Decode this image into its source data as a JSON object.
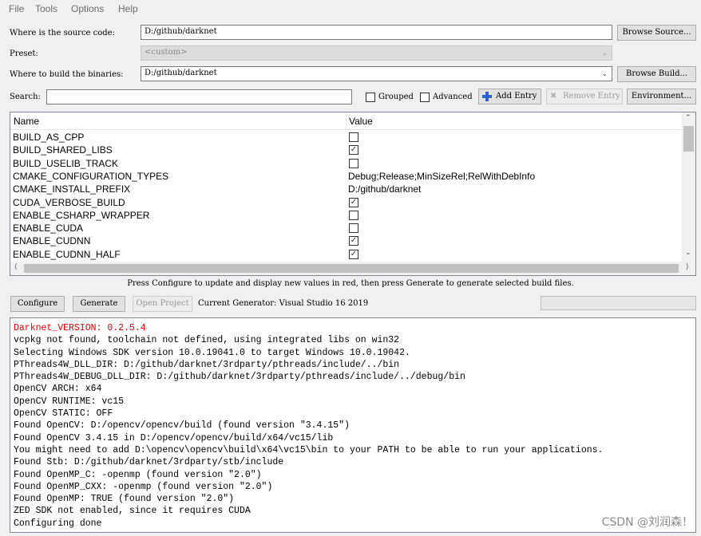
{
  "menu": [
    "File",
    "Tools",
    "Options",
    "Help"
  ],
  "source": {
    "label": "Where is the source code:",
    "value": "D:/github/darknet",
    "button": "Browse Source..."
  },
  "preset": {
    "label": "Preset:",
    "value": "<custom>"
  },
  "build": {
    "label": "Where to build the binaries:",
    "value": "D:/github/darknet",
    "button": "Browse Build..."
  },
  "search": {
    "label": "Search:",
    "value": ""
  },
  "toolbar": {
    "grouped": "Grouped",
    "advanced": "Advanced",
    "add_entry": "Add Entry",
    "remove_entry": "Remove Entry",
    "environment": "Environment..."
  },
  "table": {
    "headers": {
      "name": "Name",
      "value": "Value"
    },
    "rows": [
      {
        "name": "BUILD_AS_CPP",
        "type": "bool",
        "checked": false,
        "value": ""
      },
      {
        "name": "BUILD_SHARED_LIBS",
        "type": "bool",
        "checked": true,
        "value": ""
      },
      {
        "name": "BUILD_USELIB_TRACK",
        "type": "bool",
        "checked": false,
        "value": ""
      },
      {
        "name": "CMAKE_CONFIGURATION_TYPES",
        "type": "text",
        "checked": false,
        "value": "Debug;Release;MinSizeRel;RelWithDebInfo"
      },
      {
        "name": "CMAKE_INSTALL_PREFIX",
        "type": "text",
        "checked": false,
        "value": "D:/github/darknet"
      },
      {
        "name": "CUDA_VERBOSE_BUILD",
        "type": "bool",
        "checked": true,
        "value": ""
      },
      {
        "name": "ENABLE_CSHARP_WRAPPER",
        "type": "bool",
        "checked": false,
        "value": ""
      },
      {
        "name": "ENABLE_CUDA",
        "type": "bool",
        "checked": false,
        "value": ""
      },
      {
        "name": "ENABLE_CUDNN",
        "type": "bool",
        "checked": true,
        "value": ""
      },
      {
        "name": "ENABLE_CUDNN_HALF",
        "type": "bool",
        "checked": true,
        "value": ""
      }
    ]
  },
  "hint": "Press Configure to update and display new values in red, then press Generate to generate selected build files.",
  "actions": {
    "configure": "Configure",
    "generate": "Generate",
    "open_project": "Open Project",
    "generator": "Current Generator: Visual Studio 16 2019"
  },
  "output": [
    {
      "text": "Darknet_VERSION: 0.2.5.4",
      "color": "#e00000"
    },
    {
      "text": "vcpkg not found, toolchain not defined, using integrated libs on win32",
      "color": ""
    },
    {
      "text": "Selecting Windows SDK version 10.0.19041.0 to target Windows 10.0.19042.",
      "color": ""
    },
    {
      "text": "PThreads4W_DLL_DIR: D:/github/darknet/3rdparty/pthreads/include/../bin",
      "color": ""
    },
    {
      "text": "PThreads4W_DEBUG_DLL_DIR: D:/github/darknet/3rdparty/pthreads/include/../debug/bin",
      "color": ""
    },
    {
      "text": "OpenCV ARCH: x64",
      "color": ""
    },
    {
      "text": "OpenCV RUNTIME: vc15",
      "color": ""
    },
    {
      "text": "OpenCV STATIC: OFF",
      "color": ""
    },
    {
      "text": "Found OpenCV: D:/opencv/opencv/build (found version \"3.4.15\")",
      "color": ""
    },
    {
      "text": "Found OpenCV 3.4.15 in D:/opencv/opencv/build/x64/vc15/lib",
      "color": ""
    },
    {
      "text": "You might need to add D:\\opencv\\opencv\\build\\x64\\vc15\\bin to your PATH to be able to run your applications.",
      "color": ""
    },
    {
      "text": "Found Stb: D:/github/darknet/3rdparty/stb/include",
      "color": ""
    },
    {
      "text": "Found OpenMP_C: -openmp (found version \"2.0\")",
      "color": ""
    },
    {
      "text": "Found OpenMP_CXX: -openmp (found version \"2.0\")",
      "color": ""
    },
    {
      "text": "Found OpenMP: TRUE (found version \"2.0\")",
      "color": ""
    },
    {
      "text": "ZED SDK not enabled, since it requires CUDA",
      "color": ""
    },
    {
      "text": "Configuring done",
      "color": ""
    }
  ],
  "watermark": "CSDN @刘润森！",
  "colors": {
    "error_text": "#e00000",
    "add_icon": "#2f62c9"
  }
}
